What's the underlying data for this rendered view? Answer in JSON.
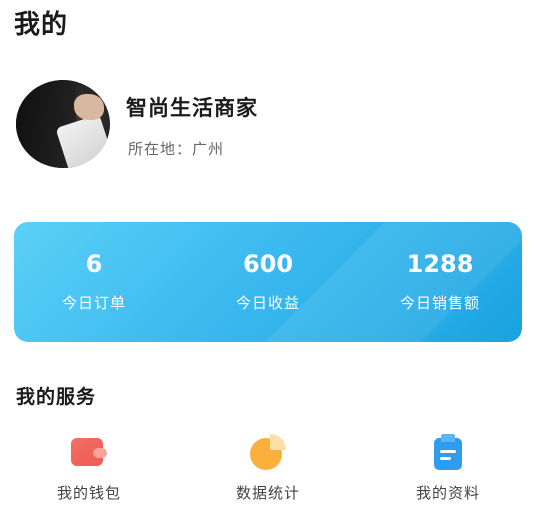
{
  "header": {
    "title": "我的"
  },
  "profile": {
    "name": "智尚生活商家",
    "location": "所在地：广州"
  },
  "stats": [
    {
      "value": "6",
      "label": "今日订单"
    },
    {
      "value": "600",
      "label": "今日收益"
    },
    {
      "value": "1288",
      "label": "今日销售额"
    }
  ],
  "services": {
    "title": "我的服务",
    "items": [
      {
        "label": "我的钱包",
        "icon": "wallet-icon",
        "color": "#f2635c"
      },
      {
        "label": "数据统计",
        "icon": "pie-chart-icon",
        "color": "#fbb03b"
      },
      {
        "label": "我的资料",
        "icon": "clipboard-icon",
        "color": "#2f9cf0"
      }
    ]
  },
  "colors": {
    "card_start": "#5bd0f6",
    "card_end": "#1aa3e0"
  }
}
